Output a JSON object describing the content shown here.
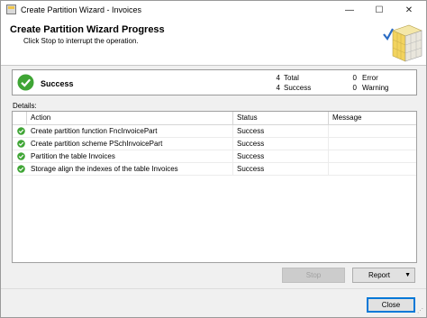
{
  "window": {
    "title": "Create Partition Wizard - Invoices",
    "controls": {
      "minimize": "—",
      "maximize": "☐",
      "close": "✕"
    }
  },
  "header": {
    "title": "Create Partition Wizard Progress",
    "subtitle": "Click Stop to interrupt the operation."
  },
  "status": {
    "text": "Success",
    "icon": "check-circle-icon",
    "counts": {
      "total": {
        "value": "4",
        "label": "Total"
      },
      "success": {
        "value": "4",
        "label": "Success"
      },
      "error": {
        "value": "0",
        "label": "Error"
      },
      "warning": {
        "value": "0",
        "label": "Warning"
      }
    }
  },
  "details": {
    "label": "Details:",
    "columns": {
      "action": "Action",
      "status": "Status",
      "message": "Message"
    },
    "rows": [
      {
        "action": "Create partition function FncInvoicePart",
        "status": "Success",
        "message": ""
      },
      {
        "action": "Create partition scheme PSchInvoicePart",
        "status": "Success",
        "message": ""
      },
      {
        "action": "Partition the table Invoices",
        "status": "Success",
        "message": ""
      },
      {
        "action": "Storage align the indexes of the table Invoices",
        "status": "Success",
        "message": ""
      }
    ]
  },
  "buttons": {
    "stop": "Stop",
    "report": "Report",
    "close": "Close"
  },
  "colors": {
    "success_green": "#3fa535",
    "accent_blue": "#0078d7"
  }
}
